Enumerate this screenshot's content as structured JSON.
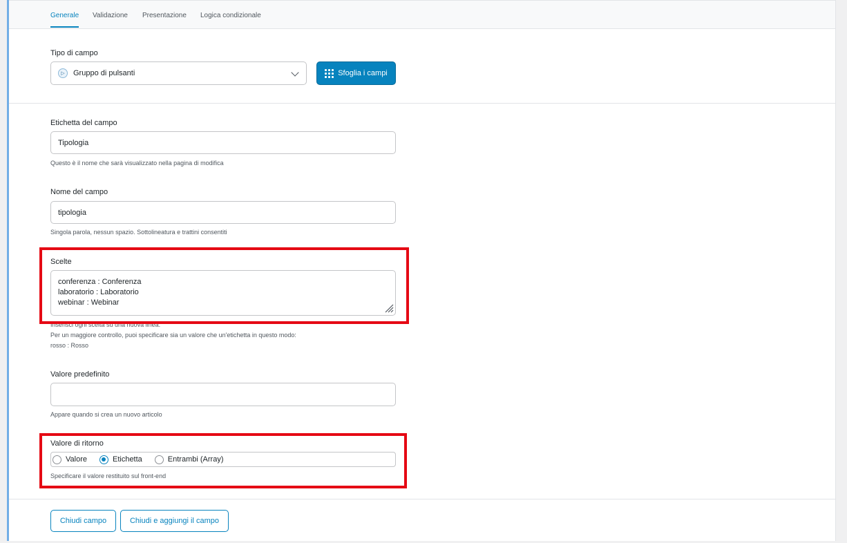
{
  "tabs": [
    "Generale",
    "Validazione",
    "Presentazione",
    "Logica condizionale"
  ],
  "field_type": {
    "label": "Tipo di campo",
    "value": "Gruppo di pulsanti",
    "icon": "button-group-icon",
    "browse_button": "Sfoglia i campi"
  },
  "field_label": {
    "label": "Etichetta del campo",
    "value": "Tipologia",
    "help": "Questo è il nome che sarà visualizzato nella pagina di modifica"
  },
  "field_name": {
    "label": "Nome del campo",
    "value": "tipologia",
    "help": "Singola parola, nessun spazio. Sottolineatura e trattini consentiti"
  },
  "choices": {
    "label": "Scelte",
    "value": "conferenza : Conferenza\nlaboratorio : Laboratorio\nwebinar : Webinar",
    "help_line1": "Inserisci ogni scelta su una nuova linea.",
    "help_line2": "Per un maggiore controllo, puoi specificare sia un valore che un'etichetta in questo modo:",
    "help_line3": "rosso : Rosso"
  },
  "default_value": {
    "label": "Valore predefinito",
    "value": "",
    "help": "Appare quando si crea un nuovo articolo"
  },
  "return_value": {
    "label": "Valore di ritorno",
    "options": [
      "Valore",
      "Etichetta",
      "Entrambi (Array)"
    ],
    "selected": "Etichetta",
    "help": "Specificare il valore restituito sul front-end"
  },
  "actions": {
    "close": "Chiudi campo",
    "close_add": "Chiudi e aggiungi il campo"
  },
  "colors": {
    "accent": "#0783be",
    "highlight": "#e50914"
  }
}
